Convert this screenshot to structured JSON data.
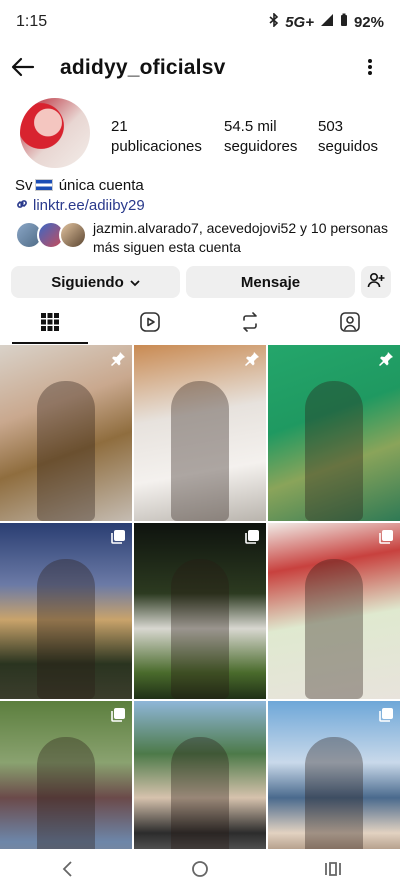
{
  "status": {
    "time": "1:15",
    "network": "5G+",
    "battery": "92%"
  },
  "header": {
    "username": "adidyy_oficialsv"
  },
  "stats": {
    "posts": {
      "value": "21",
      "label": "publicaciones"
    },
    "followers": {
      "value": "54.5 mil",
      "label": "seguidores"
    },
    "following": {
      "value": "503",
      "label": "seguidos"
    }
  },
  "bio": {
    "prefix": "Sv",
    "text": "única cuenta",
    "link": "linktr.ee/adiiby29"
  },
  "mutual": {
    "text": "jazmin.alvarado7, acevedojovi52 y 10 personas más siguen esta cuenta"
  },
  "actions": {
    "following_label": "Siguiendo",
    "message_label": "Mensaje"
  },
  "tabs": [
    "grid-icon",
    "reels-icon",
    "reposts-icon",
    "tagged-icon"
  ],
  "grid": {
    "posts": [
      {
        "badge": "pin-icon"
      },
      {
        "badge": "pin-icon"
      },
      {
        "badge": "pin-icon"
      },
      {
        "badge": "carousel-icon"
      },
      {
        "badge": "carousel-icon"
      },
      {
        "badge": "carousel-icon"
      },
      {
        "badge": "carousel-icon"
      },
      {
        "badge": ""
      },
      {
        "badge": "carousel-icon"
      }
    ]
  },
  "colors": {
    "link": "#2a3a8c",
    "button_bg": "#efefef",
    "text": "#111111"
  }
}
